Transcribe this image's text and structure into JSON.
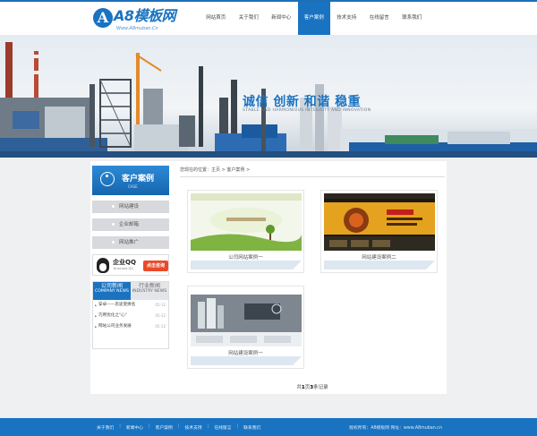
{
  "site": {
    "logo_text": "A8模板网",
    "logo_subtext": "Www.A8muban.Cn",
    "brand_color": "#1a73c1"
  },
  "nav": {
    "items": [
      {
        "label": "网站首页",
        "active": false
      },
      {
        "label": "关于我们",
        "active": false
      },
      {
        "label": "新闻中心",
        "active": false
      },
      {
        "label": "客户案例",
        "active": true
      },
      {
        "label": "技术支持",
        "active": false
      },
      {
        "label": "在线留言",
        "active": false
      },
      {
        "label": "联系我们",
        "active": false
      }
    ]
  },
  "banner": {
    "slogan": "诚信 创新 和谐 稳重",
    "slogan_en": "STABLE AND HARMONIOUS INTEGRITY AND INNOVATION"
  },
  "sidebar": {
    "title": "客户案例",
    "title_en": "CASE",
    "buttons": [
      "网站建设",
      "企业邮箱",
      "网站推广"
    ],
    "qq": {
      "label": "企业QQ",
      "sublabel": "Business QQ",
      "cta": "点击咨询"
    },
    "news_tabs": [
      {
        "label": "公司新闻",
        "en": "COMPANY NEWS",
        "active": true
      },
      {
        "label": "行业新闻",
        "en": "INDUSTRY NEWS",
        "active": false
      }
    ],
    "news_items": [
      {
        "title": "安卓——思途变换名 ",
        "date": "05-12"
      },
      {
        "title": "巧用优化之\"心\" ",
        "date": "05-12"
      },
      {
        "title": "网站公司业务发展 ",
        "date": "05-12"
      }
    ]
  },
  "content": {
    "breadcrumb": "您现在的位置：主页 > 客户案例 >",
    "cases": [
      {
        "caption": "公司网站案例一"
      },
      {
        "caption": "网站建设案例二"
      },
      {
        "caption": "网站建设案例一"
      }
    ],
    "pager": {
      "prefix": "共",
      "pages": "1",
      "mid": "页",
      "records": "3",
      "suffix": "条记录"
    }
  },
  "footer": {
    "links": [
      "关于我们",
      "新闻中心",
      "客户案例",
      "技术支持",
      "在线留言",
      "联系我们"
    ],
    "right_text": "版权所有：A8模板网  网址：www.A8muban.cn"
  }
}
